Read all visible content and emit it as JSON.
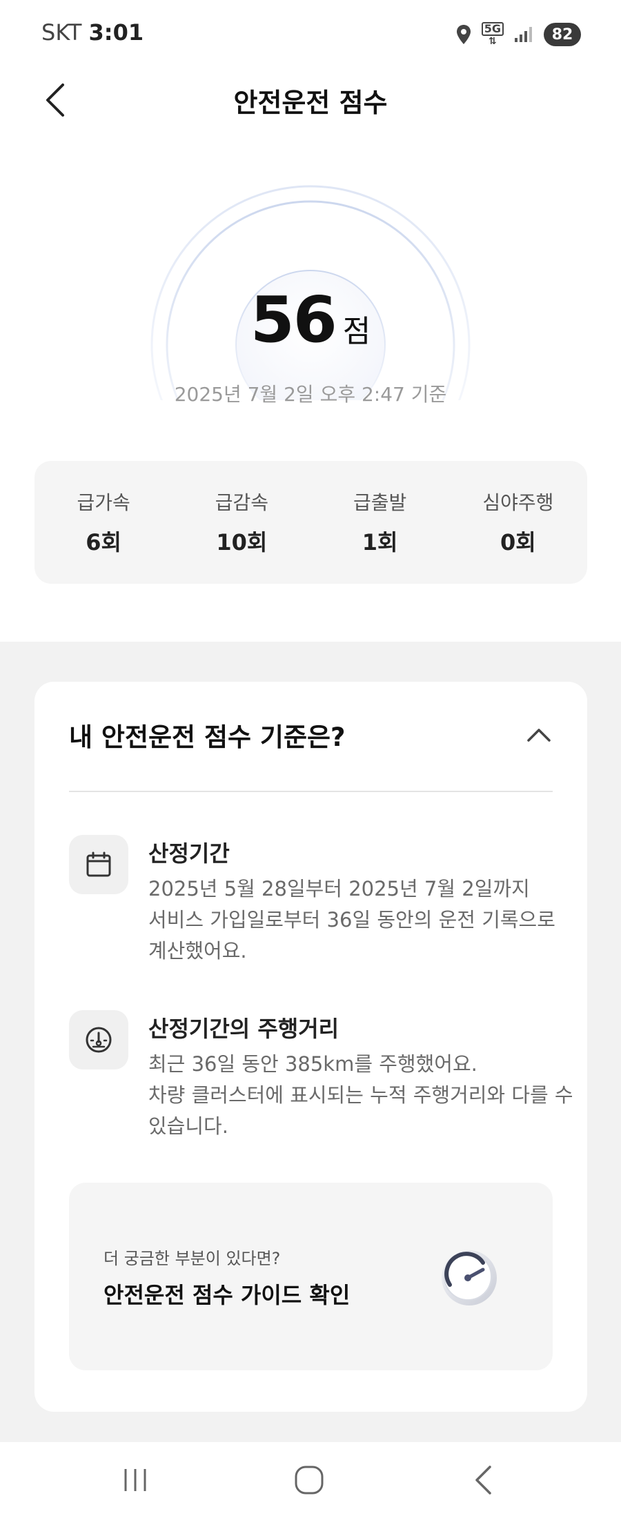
{
  "status_bar": {
    "carrier": "SKT",
    "time": "3:01",
    "network": "5G",
    "battery": "82",
    "icons": [
      "location-icon",
      "5g-icon",
      "signal-icon",
      "battery-icon"
    ]
  },
  "header": {
    "title": "안전운전 점수",
    "back_icon": "chevron-left-icon"
  },
  "score": {
    "value": "56",
    "unit": "점",
    "as_of": "2025년 7월 2일 오후 2:47 기준"
  },
  "stats": [
    {
      "label": "급가속",
      "value": "6회"
    },
    {
      "label": "급감속",
      "value": "10회"
    },
    {
      "label": "급출발",
      "value": "1회"
    },
    {
      "label": "심야주행",
      "value": "0회"
    }
  ],
  "criteria": {
    "title": "내 안전운전 점수 기준은?",
    "toggle_icon": "chevron-up-icon",
    "items": [
      {
        "icon": "calendar-icon",
        "title": "산정기간",
        "lines": [
          "2025년 5월 28일부터 2025년 7월 2일까지",
          "서비스 가입일로부터 36일 동안의 운전 기록으로",
          "계산했어요."
        ]
      },
      {
        "icon": "speedometer-icon",
        "title": "산정기간의 주행거리",
        "lines": [
          "최근 36일 동안 385km를 주행했어요.",
          "차량 클러스터에 표시되는 누적 주행거리와 다를 수",
          "있습니다."
        ]
      }
    ],
    "guide": {
      "subtitle": "더 궁금한 부분이 있다면?",
      "title": "안전운전 점수 가이드 확인",
      "icon": "gauge-icon"
    }
  },
  "nav": {
    "recents": "recents-icon",
    "home": "home-icon",
    "back": "back-icon"
  },
  "colors": {
    "background": "#ffffff",
    "panel": "#f5f5f5",
    "band": "#f2f2f2",
    "muted_text": "#9a9a9a",
    "gauge_ring": "#dfe6f5"
  }
}
